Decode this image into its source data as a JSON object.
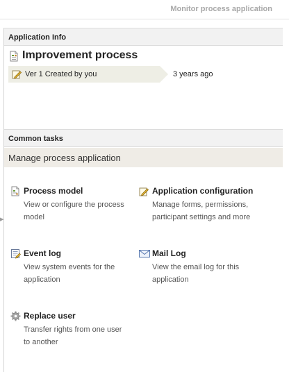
{
  "header": {
    "monitor_link": "Monitor process application"
  },
  "app_info": {
    "section_title": "Application Info",
    "title": "Improvement process",
    "version_label": "Ver 1 Created by you",
    "version_time": "3 years ago"
  },
  "common_tasks": {
    "section_title": "Common tasks",
    "band_label": "Manage process application",
    "tasks": [
      {
        "title": "Process model",
        "description": "View or configure the process model",
        "icon": "process-model-icon"
      },
      {
        "title": "Application configuration",
        "description": "Manage forms, permissions, participant settings and more",
        "icon": "pencil-icon"
      },
      {
        "title": "Event log",
        "description": "View system events for the application",
        "icon": "event-log-icon"
      },
      {
        "title": "Mail Log",
        "description": "View the email log for this application",
        "icon": "mail-icon"
      },
      {
        "title": "Replace user",
        "description": "Transfer rights from one user to another",
        "icon": "gear-icon"
      }
    ]
  },
  "colors": {
    "section_header_bg": "#f2f2f2",
    "band_bg": "#efece6",
    "version_tag_bg": "#eeeee5",
    "muted_link": "#a8a8a8"
  }
}
